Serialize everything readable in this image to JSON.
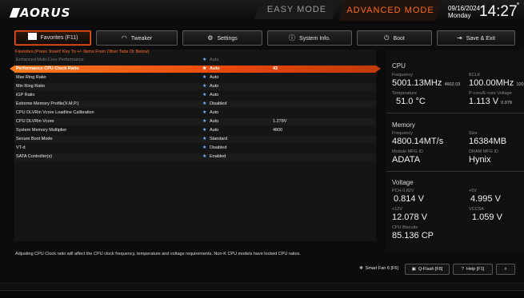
{
  "header": {
    "logo": "AORUS",
    "mode_easy": "EASY MODE",
    "mode_advanced": "ADVANCED MODE",
    "date": "09/16/2024",
    "weekday": "Monday",
    "time": "14:27"
  },
  "tabs": [
    {
      "label": "Favorites (F11)",
      "icon": "favorites-icon",
      "active": true
    },
    {
      "label": "Tweaker",
      "icon": "gauge-icon"
    },
    {
      "label": "Settings",
      "icon": "gear-icon"
    },
    {
      "label": "System Info.",
      "icon": "info-icon"
    },
    {
      "label": "Boot",
      "icon": "power-icon"
    },
    {
      "label": "Save & Exit",
      "icon": "exit-icon"
    }
  ],
  "list": {
    "hint": "Favorites (Press 'Insert' Key To +/- Items From Other Tabs Or Below)",
    "rows": [
      {
        "name": "Enhanced Multi-Core Performance",
        "value": "Auto",
        "value2": ""
      },
      {
        "name": "Performance CPU Clock Ratio",
        "value": "Auto",
        "value2": "43"
      },
      {
        "name": "Max Ring Ratio",
        "value": "Auto",
        "value2": ""
      },
      {
        "name": "Min Ring Ratio",
        "value": "Auto",
        "value2": ""
      },
      {
        "name": "iGP Ratio",
        "value": "Auto",
        "value2": ""
      },
      {
        "name": "Extreme Memory Profile(X.M.P.)",
        "value": "Disabled",
        "value2": ""
      },
      {
        "name": "CPU DLVRin Vcore Loadline Calibration",
        "value": "Auto",
        "value2": ""
      },
      {
        "name": "CPU DLVRin Vcore",
        "value": "Auto",
        "value2": "1.278V"
      },
      {
        "name": "System Memory Multiplier",
        "value": "Auto",
        "value2": "4800"
      },
      {
        "name": "Secure Boot Mode",
        "value": "Standard",
        "value2": ""
      },
      {
        "name": "VT-d",
        "value": "Disabled",
        "value2": ""
      },
      {
        "name": "SATA Controller(s)",
        "value": "Enabled",
        "value2": ""
      }
    ],
    "help": "Adjusting CPU Clock ratio will affect the CPU clock frequency, temperature and voltage requirements. Non-K CPU models have locked CPU ratios."
  },
  "monitor": {
    "cpu": {
      "title": "CPU",
      "frequency_label": "Frequency",
      "frequency": "5001.13MHz",
      "frequency_sub": "4602.03",
      "bclk_label": "BCLK",
      "bclk": "100.00MHz",
      "bclk_sub": "100",
      "temperature_label": "Temperature",
      "temperature": "51.0 °C",
      "core_voltage_label": "P-core/E-core Voltage",
      "core_voltage": "1.113 V",
      "core_voltage_sub": "0.979"
    },
    "memory": {
      "title": "Memory",
      "frequency_label": "Frequency",
      "frequency": "4800.14MT/s",
      "size_label": "Size",
      "size": "16384MB",
      "module_label": "Module MFG ID",
      "module": "ADATA",
      "dram_label": "DRAM MFG ID",
      "dram": "Hynix"
    },
    "voltage": {
      "title": "Voltage",
      "pch_label": "PCH 0.82V",
      "pch": "0.814 V",
      "v5_label": "+5V",
      "v5": "4.995 V",
      "v12_label": "+12V",
      "v12": "12.078 V",
      "vccsa_label": "VCCSA",
      "vccsa": "1.059 V",
      "biscuits_label": "CPU Biscuits",
      "biscuits": "85.136 CP"
    }
  },
  "bottom": {
    "smart_fan": "Smart Fan 6 [F6]",
    "qflash": "Q-Flash [F8]",
    "help": "Help [F1]"
  },
  "colors": {
    "accent": "#ff6a1a",
    "selected_row": "#ff7a1f",
    "star": "#7fb6ff"
  }
}
